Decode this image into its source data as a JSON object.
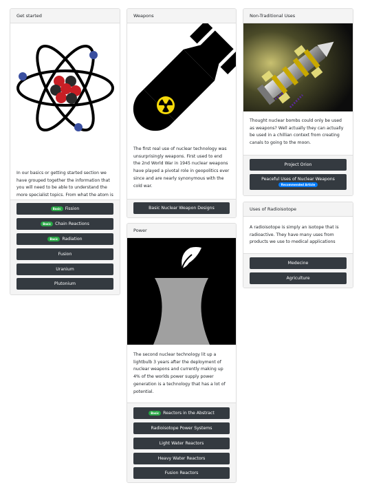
{
  "cards": {
    "get_started": {
      "title": "Get started",
      "text": "In our basics or getting started section we have grouped together the information that you will need to be able to understand the more specialist topics. From what the atom is to splitting it.",
      "buttons": [
        {
          "label": "Fission",
          "badge": "Basic"
        },
        {
          "label": "Chain Reactions",
          "badge": "Basic"
        },
        {
          "label": "Radiation",
          "badge": "Basic"
        },
        {
          "label": "Fusion"
        },
        {
          "label": "Uranium"
        },
        {
          "label": "Plutonium"
        }
      ]
    },
    "weapons": {
      "title": "Weapons",
      "text": "The first real use of nuclear technology was unsurprisingly weapons. First used to end the 2nd World War in 1945 nuclear weapons have played a pivotal role in geopolitics ever since and are nearly synonymous with the cold war.",
      "buttons": [
        {
          "label": "Basic Nuclear Weapon Designs"
        }
      ]
    },
    "power": {
      "title": "Power",
      "text": "The second nuclear technology lit up a lightbulb 3 years after the deployment of nuclear weapons and currently making up 4% of the worlds power supply power generation is a technology that has a lot of potential.",
      "buttons": [
        {
          "label": "Reactors in the Abstract",
          "badge": "Basic"
        },
        {
          "label": "Radioisotope Power Systems"
        },
        {
          "label": "Light Water Reactors"
        },
        {
          "label": "Heavy Water Reactors"
        },
        {
          "label": "Fusion Reactors"
        }
      ]
    },
    "non_traditional": {
      "title": "Non-Traditional Uses",
      "text": "Thought nuclear bombs could only be used as weapons? Well actually they can actually be used in a chillian context from creating canals to going to the moon.",
      "buttons": [
        {
          "label": "Project Orion"
        },
        {
          "label": "Peaceful Uses of Nuclear Weapons",
          "badge": "Recommended Article"
        }
      ]
    },
    "radioisotope": {
      "title": "Uses of Radioisotope",
      "text": "A radioisotope is simply an isotope that is radioactive. They have many uses from products we use to medical applications",
      "buttons": [
        {
          "label": "Medecine"
        },
        {
          "label": "Agriculture"
        }
      ]
    }
  },
  "colors": {
    "button_bg": "#343a40",
    "badge_basic": "#28a745",
    "badge_recommended": "#007bff",
    "header_bg": "#f4f4f4"
  },
  "icons": [
    "atom-illustration",
    "bomb-radiation-icon",
    "cooling-tower-illustration",
    "spacecraft-illustration"
  ]
}
